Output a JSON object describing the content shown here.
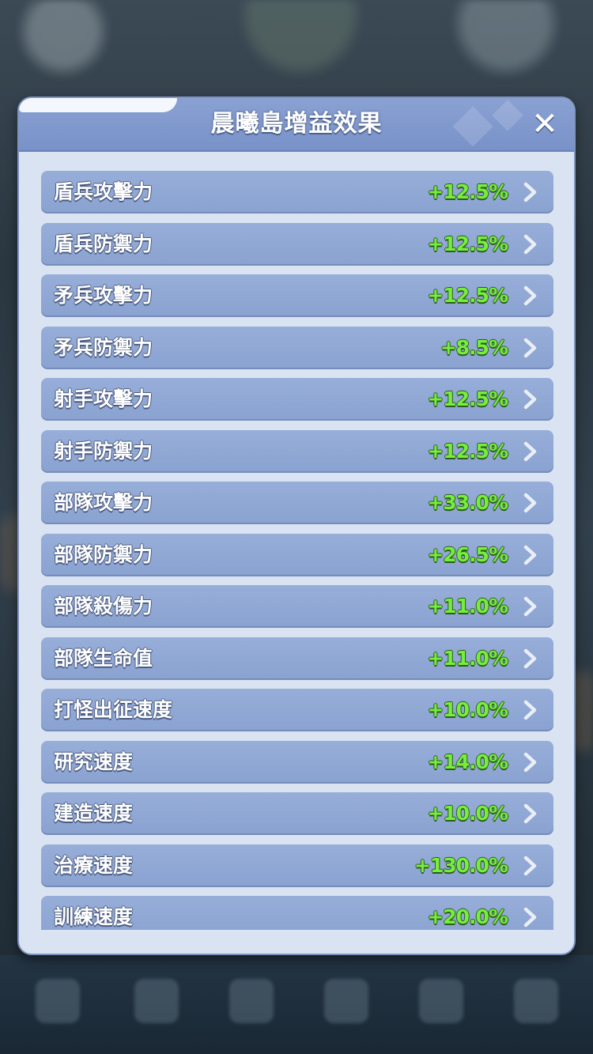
{
  "dialog": {
    "title": "晨曦島增益效果",
    "close_label": "✕"
  },
  "buffs": [
    {
      "label": "盾兵攻擊力",
      "value": "+12.5%"
    },
    {
      "label": "盾兵防禦力",
      "value": "+12.5%"
    },
    {
      "label": "矛兵攻擊力",
      "value": "+12.5%"
    },
    {
      "label": "矛兵防禦力",
      "value": "+8.5%"
    },
    {
      "label": "射手攻擊力",
      "value": "+12.5%"
    },
    {
      "label": "射手防禦力",
      "value": "+12.5%"
    },
    {
      "label": "部隊攻擊力",
      "value": "+33.0%"
    },
    {
      "label": "部隊防禦力",
      "value": "+26.5%"
    },
    {
      "label": "部隊殺傷力",
      "value": "+11.0%"
    },
    {
      "label": "部隊生命值",
      "value": "+11.0%"
    },
    {
      "label": "打怪出征速度",
      "value": "+10.0%"
    },
    {
      "label": "研究速度",
      "value": "+14.0%"
    },
    {
      "label": "建造速度",
      "value": "+10.0%"
    },
    {
      "label": "治療速度",
      "value": "+130.0%"
    },
    {
      "label": "訓練速度",
      "value": "+20.0%"
    }
  ],
  "icons": {
    "close": "close-icon",
    "row_arrow": "chevron-right-icon"
  },
  "colors": {
    "header": "#7892c9",
    "panel": "#d9e3f1",
    "row": "#8aa2d0",
    "value_green": "#76ee3d"
  }
}
